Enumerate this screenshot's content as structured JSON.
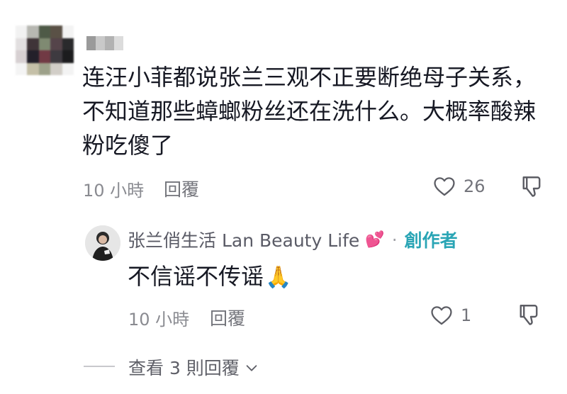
{
  "comment": {
    "text": "连汪小菲都说张兰三观不正要断绝母子关系，不知道那些蟑螂粉丝还在洗什么。大概率酸辣粉吃傻了",
    "time": "10 小時",
    "reply_label": "回覆",
    "like_count": "26"
  },
  "reply": {
    "author": "张兰俏生活 Lan Beauty Life",
    "author_emoji": "💕",
    "separator": "·",
    "badge": "創作者",
    "text": "不信谣不传谣",
    "text_emoji": "🙏",
    "time": "10 小時",
    "reply_label": "回覆",
    "like_count": "1"
  },
  "view_replies": {
    "label": "查看 3 則回覆"
  },
  "colors": {
    "text_primary": "#161823",
    "text_secondary": "#73747b",
    "creator_badge": "#2aa5b5"
  },
  "icons": {
    "like": "heart-outline-icon",
    "dislike": "thumbs-down-outline-icon",
    "expand": "chevron-down-icon"
  }
}
